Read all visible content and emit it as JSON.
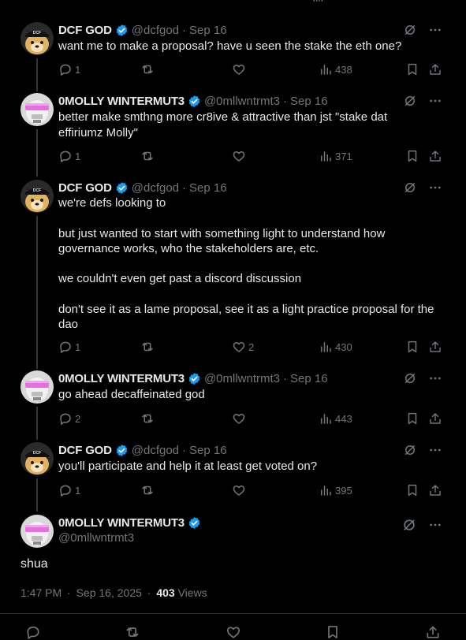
{
  "tweets": [
    {
      "name": "DCF GOD",
      "handle": "@dcfgod",
      "date": "Sep 16",
      "text": "want me to make a proposal? have u seen the stake the eth one?",
      "replies": "1",
      "retweets": "",
      "likes": "",
      "views": "438"
    },
    {
      "name": "0MOLLY WINTERMUT3",
      "handle": "@0mllwntrmt3",
      "date": "Sep 16",
      "text": "better make smthng more cr8ive & attractive than jst \"stake dat effiriumz Molly\"",
      "replies": "1",
      "retweets": "",
      "likes": "",
      "views": "371"
    },
    {
      "name": "DCF GOD",
      "handle": "@dcfgod",
      "date": "Sep 16",
      "text": "we're defs looking to\n\nbut just wanted to start with something light to understand how governance works, who the stakeholders are, etc.\n\nwe couldn't even get past a discord discussion\n\ndon't see it as a lame proposal, see it as a light practice proposal for the dao",
      "replies": "1",
      "retweets": "",
      "likes": "2",
      "views": "430"
    },
    {
      "name": "0MOLLY WINTERMUT3",
      "handle": "@0mllwntrmt3",
      "date": "Sep 16",
      "text": "go ahead decaffeinated god",
      "replies": "2",
      "retweets": "",
      "likes": "",
      "views": "443"
    },
    {
      "name": "DCF GOD",
      "handle": "@dcfgod",
      "date": "Sep 16",
      "text": "you'll participate and help it at least get voted on?",
      "replies": "1",
      "retweets": "",
      "likes": "",
      "views": "395"
    }
  ],
  "main": {
    "name": "0MOLLY WINTERMUT3",
    "handle": "@0mllwntrmt3",
    "text": "shua",
    "time": "1:47 PM",
    "date": "Sep 16, 2025",
    "views_count": "403",
    "views_label": "Views"
  },
  "separator": "·",
  "colors": {
    "verified": "#1d9bf0",
    "muted": "#71767b",
    "text": "#e7e9ea",
    "background": "#000000"
  }
}
